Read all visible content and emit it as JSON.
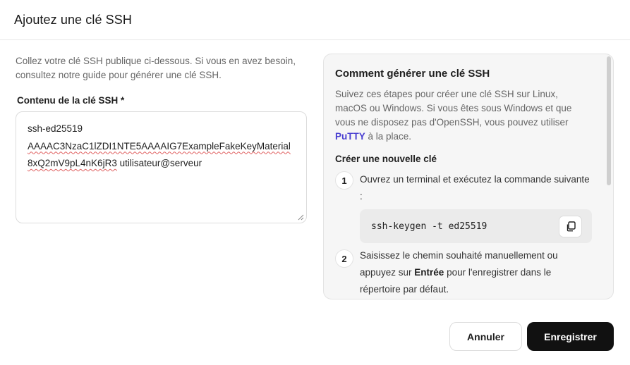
{
  "dialog": {
    "title": "Ajoutez une clé SSH"
  },
  "form": {
    "intro": "Collez votre clé SSH publique ci-dessous. Si vous en avez besoin, consultez notre guide pour générer une clé SSH.",
    "field_label": "Contenu de la clé SSH *",
    "key_line1": "ssh-ed25519",
    "key_line2_underlined": "AAAAC3NzaC1lZDI1NTE5AAAAIG7ExampleFakeKeyMaterial8xQ2mV9pL4nK6jR3",
    "key_line2_rest": " utilisateur@serveur"
  },
  "guide": {
    "title": "Comment générer une clé SSH",
    "desc_before_link": "Suivez ces étapes pour créer une clé SSH sur Linux, macOS ou Windows. Si vous êtes sous Windows et que vous ne disposez pas d'OpenSSH, vous pouvez utiliser ",
    "desc_link": "PuTTY",
    "desc_after_link": " à la place.",
    "section_title": "Créer une nouvelle clé",
    "steps": [
      {
        "number": "1",
        "text": "Ouvrez un terminal et exécutez la commande suivante :",
        "code": "ssh-keygen -t ed25519"
      },
      {
        "number": "2",
        "text_before": "Saisissez le chemin souhaité manuellement ou appuyez sur ",
        "text_bold": "Entrée",
        "text_after": " pour l'enregistrer dans le répertoire par défaut."
      }
    ]
  },
  "footer": {
    "cancel_label": "Annuler",
    "save_label": "Enregistrer"
  },
  "icons": {
    "copy": "copy-icon",
    "resize": "resize-grip-icon"
  }
}
